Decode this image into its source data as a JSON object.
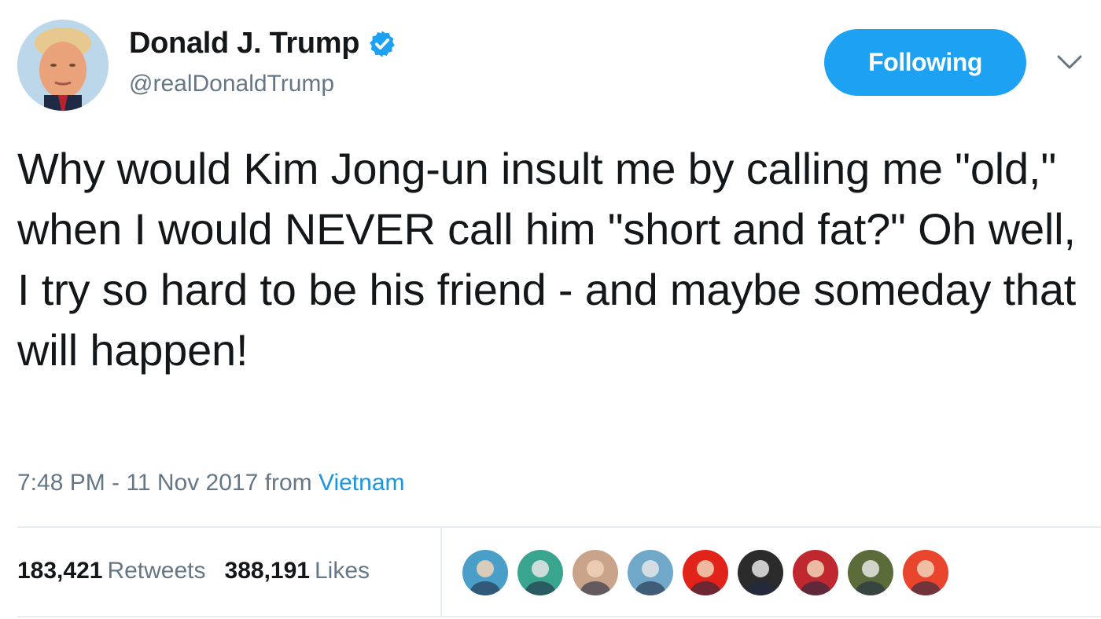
{
  "author": {
    "name": "Donald J. Trump",
    "handle": "@realDonaldTrump",
    "verified": true
  },
  "follow_button": {
    "label": "Following"
  },
  "tweet": {
    "text": "Why would Kim Jong-un insult me by calling me \"old,\" when I would NEVER call him \"short and fat?\" Oh well, I try so hard to be his friend - and maybe someday that will happen!",
    "timestamp": "7:48 PM - 11 Nov 2017",
    "from_label": "from",
    "location": "Vietnam"
  },
  "stats": {
    "retweets_count": "183,421",
    "retweets_label": "Retweets",
    "likes_count": "388,191",
    "likes_label": "Likes"
  },
  "likers": [
    {
      "icon": "liker-avatar-1",
      "color": "#4a9fc9"
    },
    {
      "icon": "liker-avatar-2",
      "color": "#3aa58e"
    },
    {
      "icon": "liker-avatar-3",
      "color": "#c9a48a"
    },
    {
      "icon": "liker-avatar-4",
      "color": "#6fa8c9"
    },
    {
      "icon": "liker-avatar-5",
      "color": "#e2231a"
    },
    {
      "icon": "liker-avatar-6",
      "color": "#2b2b2b"
    },
    {
      "icon": "liker-avatar-7",
      "color": "#c0282f"
    },
    {
      "icon": "liker-avatar-8",
      "color": "#5c6b3a"
    },
    {
      "icon": "liker-avatar-9",
      "color": "#e8452c"
    }
  ],
  "colors": {
    "accent": "#1da1f2",
    "link": "#1b95e0",
    "secondary_text": "#657786",
    "primary_text": "#14171a"
  }
}
